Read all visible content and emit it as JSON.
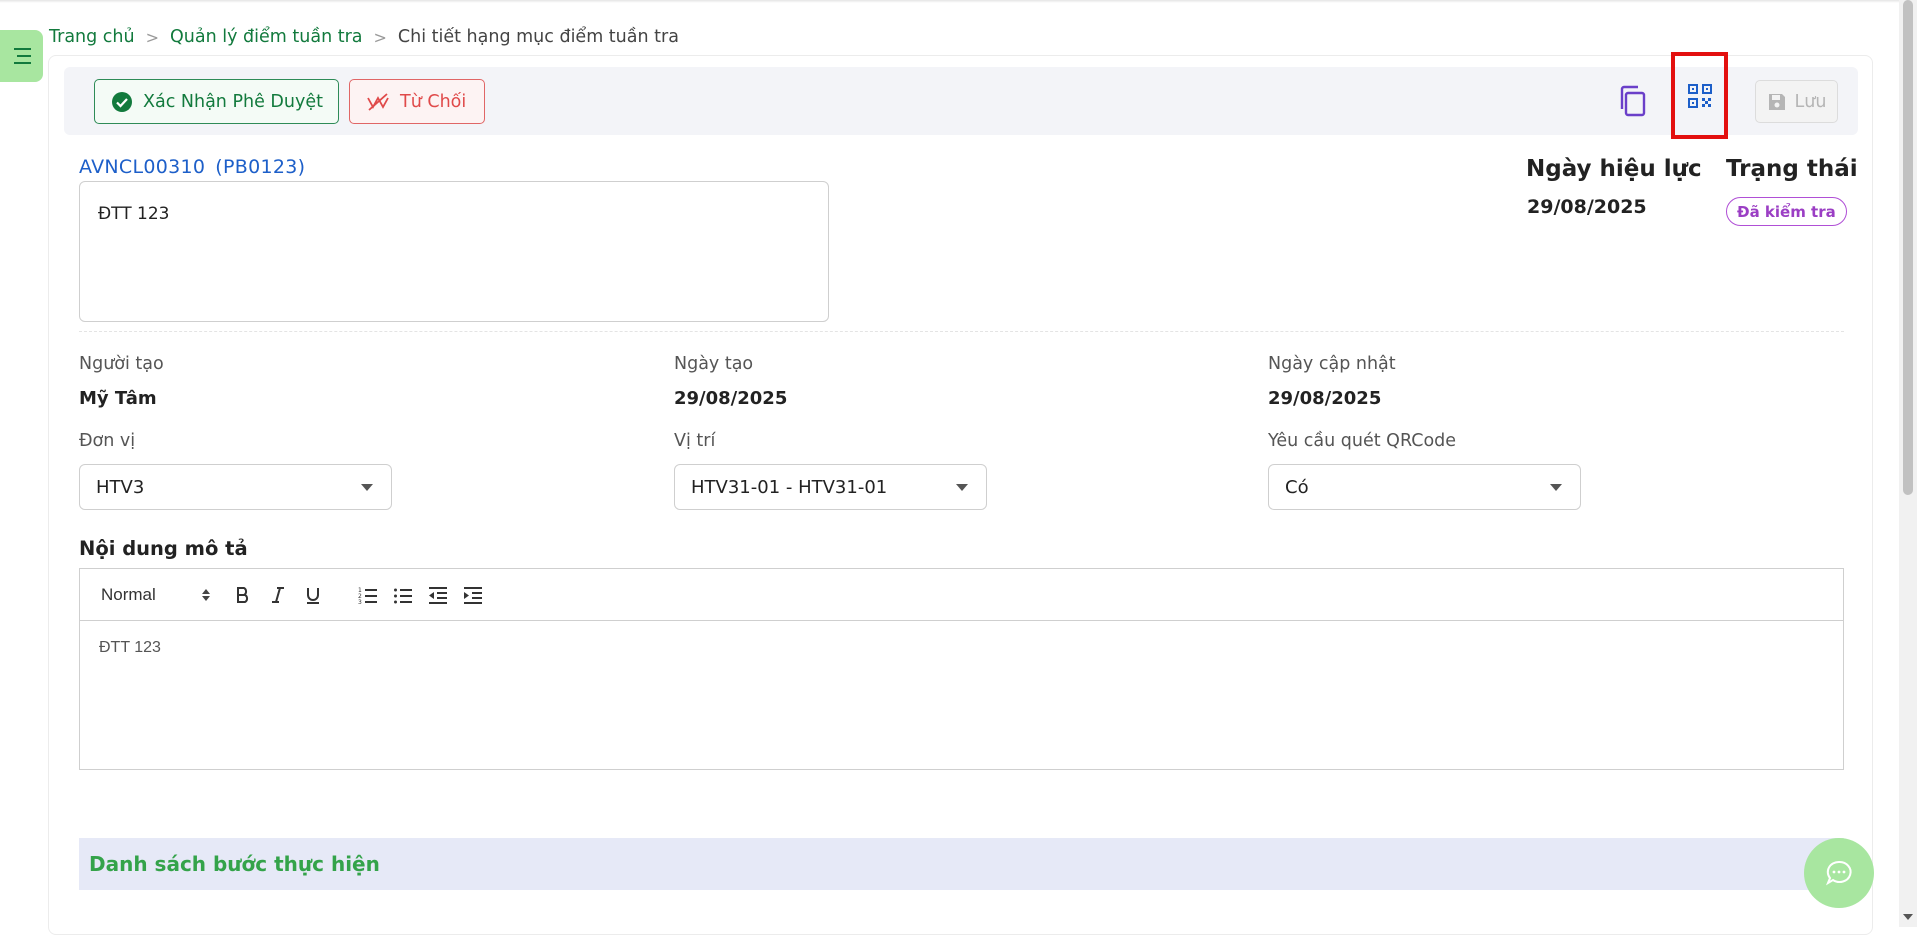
{
  "breadcrumb": {
    "home": "Trang chủ",
    "section": "Quản lý điểm tuần tra",
    "current": "Chi tiết hạng mục điểm tuần tra",
    "separator": ">"
  },
  "toolbar": {
    "approve_label": "Xác Nhận Phê Duyệt",
    "reject_label": "Từ Chối",
    "save_label": "Lưu"
  },
  "record": {
    "code": "AVNCL00310",
    "sub_code": "(PB0123)",
    "name": "ĐTT 123",
    "effective_date_label": "Ngày hiệu lực",
    "effective_date": "29/08/2025",
    "status_label": "Trạng thái",
    "status": "Đã kiểm tra"
  },
  "info": {
    "creator_label": "Người tạo",
    "creator": "Mỹ Tâm",
    "created_label": "Ngày tạo",
    "created": "29/08/2025",
    "updated_label": "Ngày cập nhật",
    "updated": "29/08/2025"
  },
  "fields": {
    "unit_label": "Đơn vị",
    "unit": "HTV3",
    "location_label": "Vị trí",
    "location": "HTV31-01 - HTV31-01",
    "qr_label": "Yêu cầu quét QRCode",
    "qr": "Có"
  },
  "description": {
    "title": "Nội dung mô tả",
    "format": "Normal",
    "content": "ĐTT 123"
  },
  "steps": {
    "title": "Danh sách bước thực hiện"
  },
  "colors": {
    "brand_green": "#127a3d",
    "accent_blue": "#1d5fc9",
    "reject_red": "#e04a4a",
    "highlight_red": "#e3100f",
    "status_purple": "#9b3ec4"
  }
}
